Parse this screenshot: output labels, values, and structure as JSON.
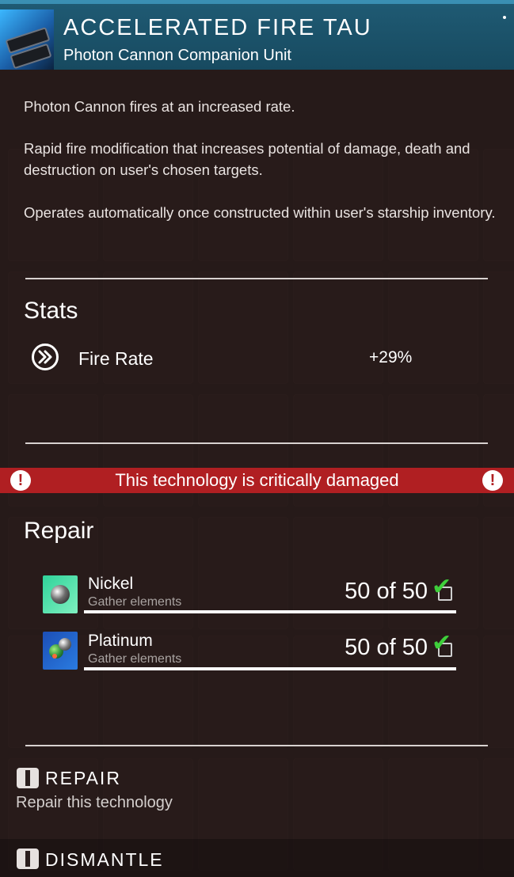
{
  "header": {
    "title": "ACCELERATED FIRE TAU",
    "subtitle": "Photon Cannon Companion Unit",
    "icon": "photon-cannon-icon"
  },
  "description": [
    "Photon Cannon fires at an increased rate.",
    "Rapid fire modification that increases potential of damage, death and destruction on user's chosen targets.",
    "Operates automatically once constructed within user's starship inventory."
  ],
  "stats": {
    "title": "Stats",
    "items": [
      {
        "label": "Fire Rate",
        "value": "+29%",
        "icon": "fire-rate-icon"
      }
    ]
  },
  "alert": {
    "text": "This technology is critically damaged",
    "icon": "exclamation-icon",
    "color": "#b01f22"
  },
  "repair": {
    "title": "Repair",
    "resources": [
      {
        "name": "Nickel",
        "subtitle": "Gather elements",
        "count": "50 of 50",
        "icon": "nickel-icon"
      },
      {
        "name": "Platinum",
        "subtitle": "Gather elements",
        "count": "50 of 50",
        "icon": "platinum-icon"
      }
    ]
  },
  "actions": {
    "repair_label": "REPAIR",
    "repair_sub": "Repair this technology",
    "dismantle_label": "DISMANTLE"
  },
  "colors": {
    "header": "#1f5a73",
    "alert": "#b01f22",
    "check": "#3ecf3a"
  }
}
